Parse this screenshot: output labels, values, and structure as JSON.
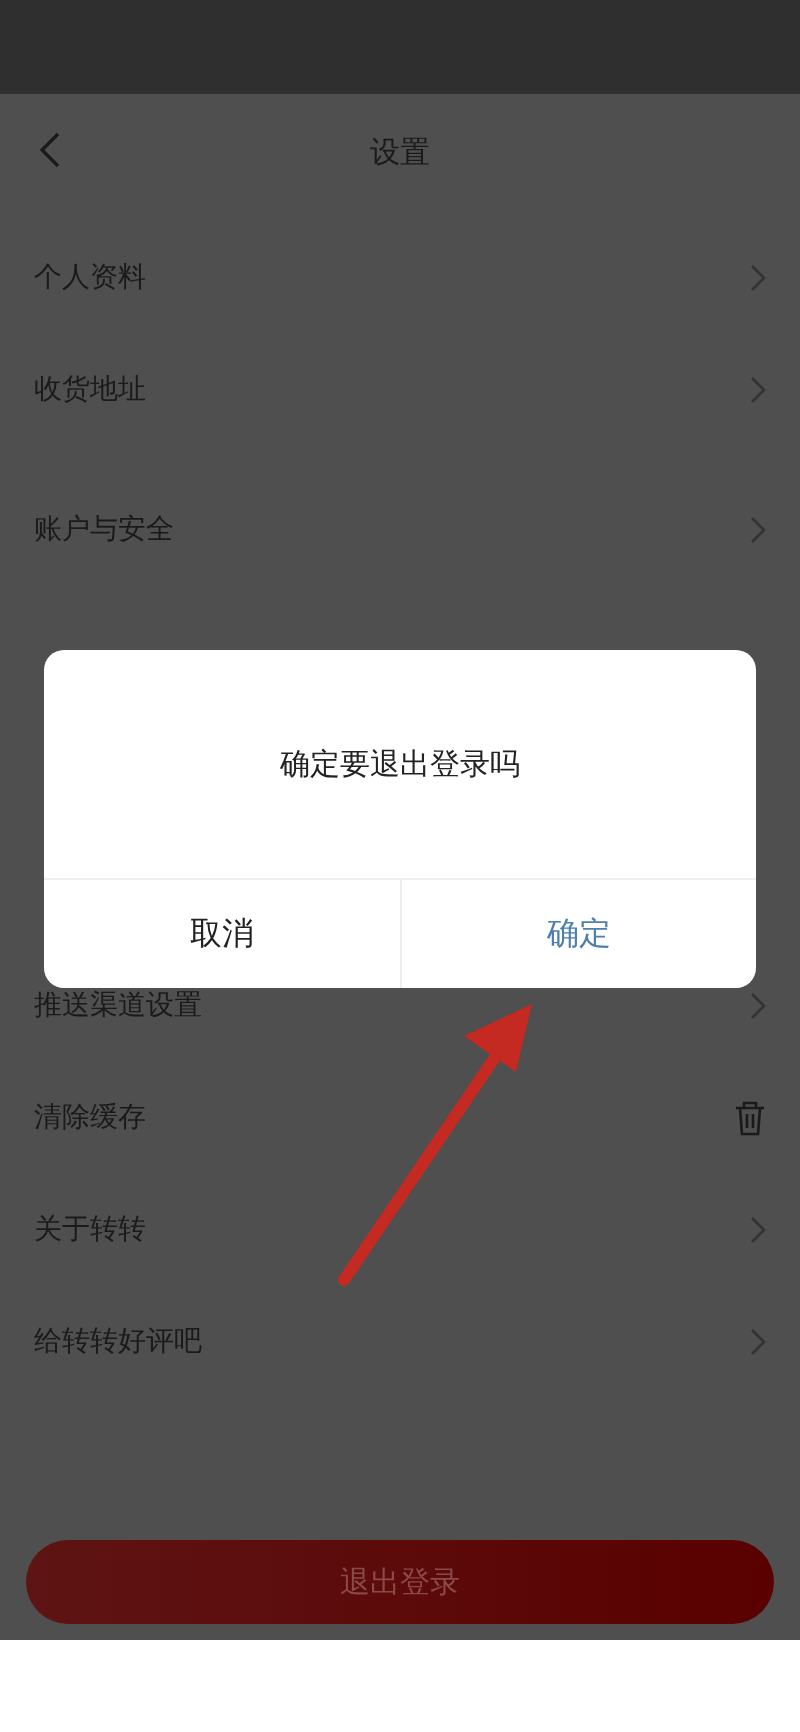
{
  "header": {
    "title": "设置"
  },
  "items": [
    {
      "label": "个人资料",
      "kind": "chevron",
      "section_start": false
    },
    {
      "label": "收货地址",
      "kind": "chevron",
      "section_start": false
    },
    {
      "label": "账户与安全",
      "kind": "chevron",
      "section_start": true
    },
    {
      "kind": "covered",
      "section_start": true
    },
    {
      "kind": "covered",
      "section_start": false
    },
    {
      "kind": "covered",
      "section_start": false
    },
    {
      "label": "推送渠道设置",
      "kind": "chevron",
      "section_start": false
    },
    {
      "label": "清除缓存",
      "kind": "trash",
      "section_start": false
    },
    {
      "label": "关于转转",
      "kind": "chevron",
      "section_start": false
    },
    {
      "label": "给转转好评吧",
      "kind": "chevron",
      "section_start": false
    }
  ],
  "logout_button": "退出登录",
  "dialog": {
    "message": "确定要退出登录吗",
    "buttons": [
      {
        "label": "取消",
        "primary": false
      },
      {
        "label": "确定",
        "primary": true
      }
    ]
  }
}
